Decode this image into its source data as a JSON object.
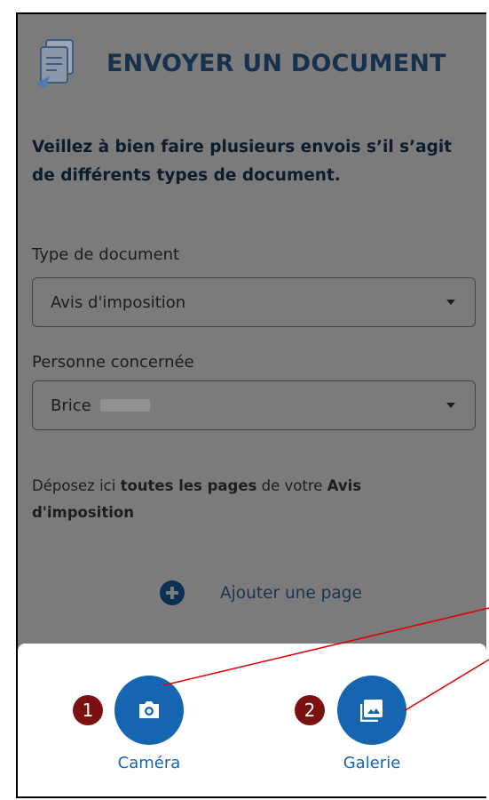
{
  "header": {
    "title": "ENVOYER UN DOCUMENT",
    "icon": "document-send-icon"
  },
  "notice": "Veillez à bien faire plusieurs envois s’il s’agit de différents types de document.",
  "document_type": {
    "label": "Type de document",
    "value": "Avis d'imposition"
  },
  "person": {
    "label": "Personne concernée",
    "value": "Brice"
  },
  "deposit": {
    "prefix": "Déposez ici ",
    "bold1": "toutes les pages",
    "middle": " de votre ",
    "bold2": "Avis d'imposition"
  },
  "add_page": {
    "label": "Ajouter une page",
    "icon": "plus-circle-icon"
  },
  "sheet": {
    "camera": {
      "badge": "1",
      "label": "Caméra",
      "icon": "camera-icon"
    },
    "gallery": {
      "badge": "2",
      "label": "Galerie",
      "icon": "image-icon"
    }
  },
  "colors": {
    "primary": "#1565b0",
    "navy": "#16304d",
    "overlay": "#7b7b7b",
    "badge": "#7a1010",
    "annotation": "#e00000"
  }
}
